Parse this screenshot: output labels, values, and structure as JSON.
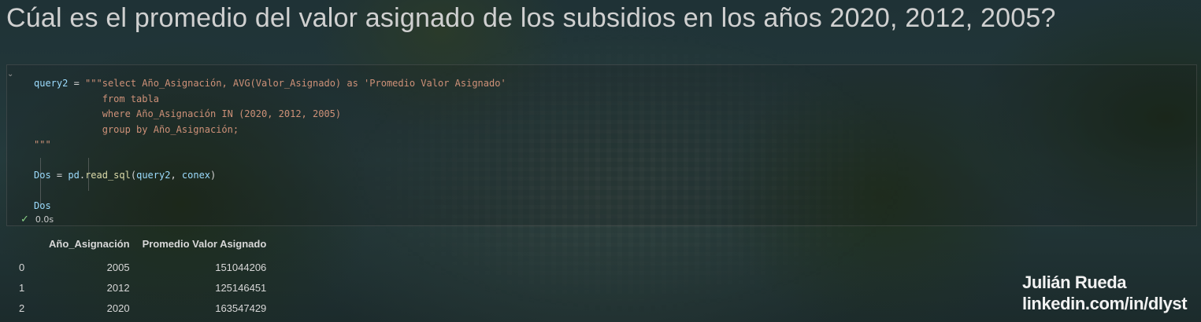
{
  "title": "Cúal es el promedio del valor asignado de los subsidios en los años 2020, 2012, 2005?",
  "code": {
    "line1_var": "query2",
    "line1_op": " = ",
    "line1_str": "\"\"\"select Año_Asignación, AVG(Valor_Asignado) as 'Promedio Valor Asignado'",
    "line2": "            from tabla",
    "line3": "            where Año_Asignación IN (2020, 2012, 2005)",
    "line4": "            group by Año_Asignación;",
    "line5": "\"\"\"",
    "line7_var": "Dos",
    "line7_op1": " = ",
    "line7_mod": "pd",
    "line7_dot": ".",
    "line7_fn": "read_sql",
    "line7_p1": "(",
    "line7_a1": "query2",
    "line7_comma": ", ",
    "line7_a2": "conex",
    "line7_p2": ")",
    "line9_var": "Dos"
  },
  "status": {
    "icon": "check-icon",
    "time": "0.0s"
  },
  "table": {
    "columns": [
      "Año_Asignación",
      "Promedio Valor Asignado"
    ],
    "rows": [
      {
        "index": "0",
        "year": "2005",
        "avg": "151044206"
      },
      {
        "index": "1",
        "year": "2012",
        "avg": "125146451"
      },
      {
        "index": "2",
        "year": "2020",
        "avg": "163547429"
      }
    ]
  },
  "watermark": {
    "name": "Julián Rueda",
    "link": "linkedin.com/in/dlyst"
  }
}
